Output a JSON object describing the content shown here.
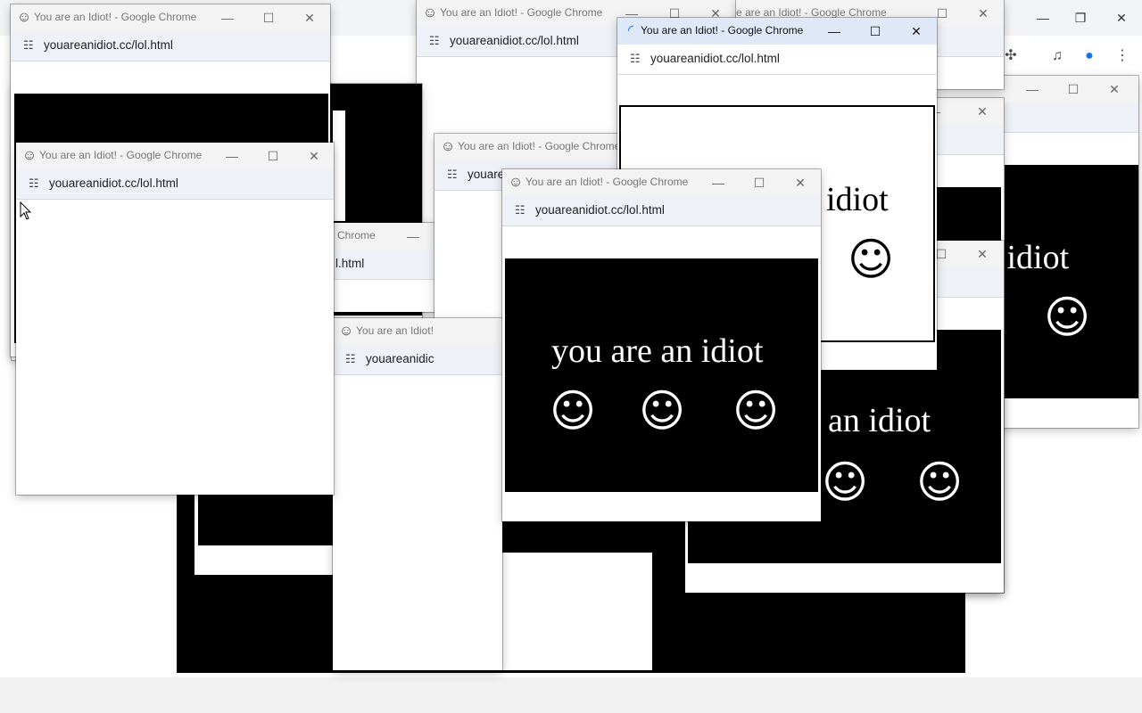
{
  "window_title": "You are an Idiot! - Google Chrome",
  "window_title_short": "You are an Idiot!",
  "url": "youareanidiot.cc/lol.html",
  "url_partial_1": "youare",
  "url_partial_2": "youareanidic",
  "url_partial_3": "l.html",
  "title_fragment_1": "e are an Idiot! - Google Chrome",
  "title_fragment_2": "Chrome",
  "page_text": "you are an idiot",
  "page_text_partial_1": "idiot",
  "page_text_partial_2": "n idiot",
  "page_text_partial_3": "re an idiot",
  "icons": {
    "favicon": "smiley-icon",
    "minimize": "minimize-icon",
    "maximize": "maximize-icon",
    "close": "close-icon",
    "tune": "tune-icon",
    "loading": "loading-spinner-icon"
  },
  "glyphs": {
    "smiley": "☺",
    "minimize": "—",
    "maximize": "☐",
    "close": "✕",
    "restore": "❐",
    "tune": "☷",
    "spinner": "◜",
    "extensions": "✣",
    "media": "♫",
    "profile": "●",
    "menu": "⋮"
  },
  "colors": {
    "page_bg": "#ffffff",
    "panel_bg": "#000000",
    "panel_text": "#ffffff",
    "titlebar_inactive": "#f3f3f3",
    "titlebar_active": "#dfe8f6",
    "address_bar": "#eef2f8",
    "profile_icon": "#1a73e8"
  }
}
